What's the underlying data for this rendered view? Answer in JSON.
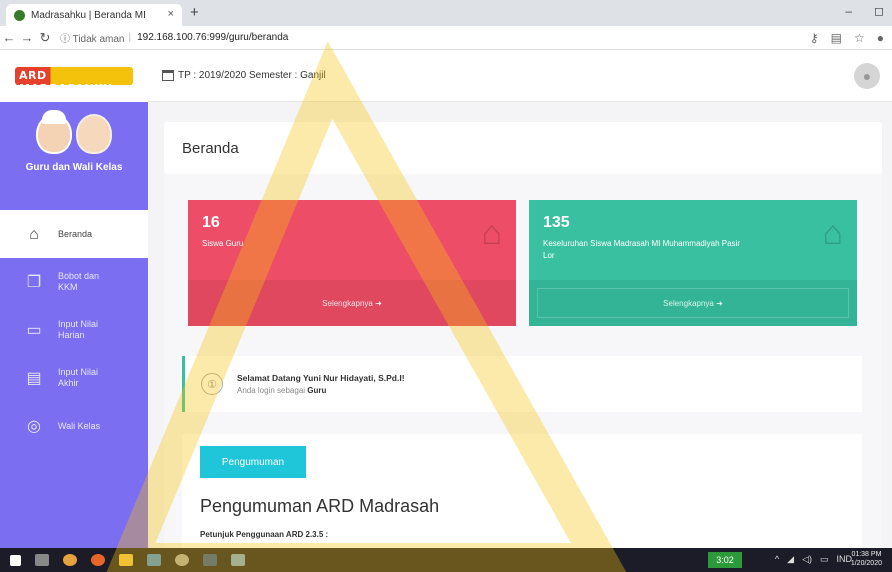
{
  "browser": {
    "tab_title": "Madrasahku | Beranda MI",
    "close_glyph": "×",
    "new_tab_glyph": "+",
    "security_text": "ⓘ Tidak aman",
    "url": "192.168.100.76:999/guru/beranda",
    "window_controls": [
      "–",
      "◻"
    ]
  },
  "header": {
    "logo_text": "ARD MADRASAHKU",
    "period": "TP : 2019/2020  Semester : Ganjil"
  },
  "sidebar": {
    "role": "Guru dan Wali Kelas",
    "items": [
      {
        "label": "Beranda",
        "icon": "home-icon",
        "active": true
      },
      {
        "label": "Bobot dan KKM",
        "icon": "copy-icon",
        "active": false
      },
      {
        "label": "Input Nilai Harian",
        "icon": "form-icon",
        "active": false
      },
      {
        "label": "Input Nilai Akhir",
        "icon": "document-icon",
        "active": false
      },
      {
        "label": "Wali Kelas",
        "icon": "user-icon",
        "active": false
      }
    ]
  },
  "page": {
    "title": "Beranda"
  },
  "stats": [
    {
      "number": "16",
      "label": "Siswa Guru",
      "link": "Selengkapnya",
      "color": "#ee4d67"
    },
    {
      "number": "135",
      "label": "Keseluruhan Siswa Madrasah MI Muhammadiyah Pasir Lor",
      "link": "Selengkapnya",
      "color": "#38c0a0"
    }
  ],
  "welcome": {
    "title": "Selamat Datang Yuni Nur Hidayati, S.Pd.I!",
    "subtitle_prefix": "Anda login sebagai",
    "role": "Guru"
  },
  "announcement": {
    "button": "Pengumuman",
    "title": "Pengumuman ARD Madrasah",
    "subtitle": "Petunjuk Penggunaan ARD 2.3.5 :"
  },
  "taskbar": {
    "badge": "3:02",
    "lang": "IND",
    "time": "01:38 PM",
    "date": "1/20/2020"
  },
  "colors": {
    "sidebar": "#7b6ef0",
    "red_card": "#ee4d67",
    "green_card": "#38c0a0",
    "announce_button": "#1fc5d8"
  }
}
